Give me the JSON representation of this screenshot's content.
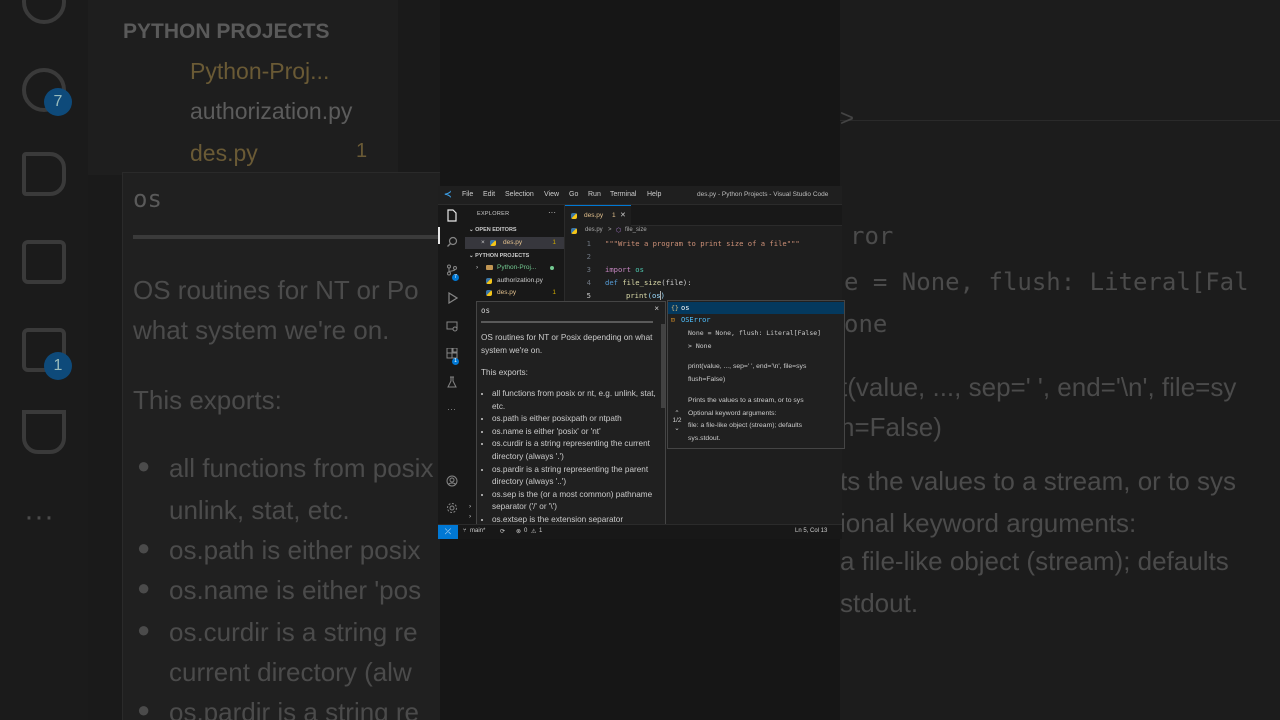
{
  "background": {
    "section_header": "PYTHON PROJECTS",
    "folder": "Python-Proj...",
    "file1": "authorization.py",
    "file2": "des.py",
    "file2_count": "1",
    "hover_title": "os",
    "hover_lines": [
      "OS routines for NT or Po",
      "what system we're on.",
      "This exports:",
      "all functions from posix",
      "unlink, stat, etc.",
      "os.path is either posix",
      "os.name is either 'pos",
      "os.curdir is a string re",
      "current directory (alw",
      "os.pardir is a string re"
    ],
    "right_lines": [
      "ror",
      "e = None, flush: Literal[Fal",
      "one",
      "t(value, ..., sep=' ', end='\\n', file=sy",
      "n=False)",
      "ts the values to a stream, or to sys",
      "ional keyword arguments:",
      "a file-like object (stream); defaults",
      "stdout."
    ],
    "badge_scm": "7",
    "badge_ext": "1"
  },
  "window": {
    "title": "des.py - Python Projects - Visual Studio Code",
    "menu": [
      "File",
      "Edit",
      "Selection",
      "View",
      "Go",
      "Run",
      "Terminal",
      "Help"
    ]
  },
  "activity": {
    "scm_badge": "7",
    "ext_badge": "1"
  },
  "sidebar": {
    "title": "EXPLORER",
    "open_editors_label": "OPEN EDITORS",
    "open_editors": [
      {
        "name": "des.py",
        "count": "1"
      }
    ],
    "project_label": "PYTHON PROJECTS",
    "items": [
      {
        "name": "Python-Proj...",
        "type": "folder"
      },
      {
        "name": "authorization.py",
        "type": "file"
      },
      {
        "name": "des.py",
        "type": "file",
        "count": "1"
      }
    ]
  },
  "tab": {
    "name": "des.py",
    "count": "1"
  },
  "breadcrumb": {
    "file": "des.py",
    "separator": ">",
    "symbol": "file_size"
  },
  "editor": {
    "line_numbers": [
      "1",
      "2",
      "3",
      "4",
      "5"
    ],
    "line1": "\"\"\"Write a program to print size of a file\"\"\"",
    "line3_kw": "import",
    "line3_mod": "os",
    "line4_kw": "def",
    "line4_fn": "file_size",
    "line4_rest": "(file):",
    "line5_fn": "print",
    "line5_rest": "(os)"
  },
  "suggest": {
    "items": [
      {
        "icon": "{}",
        "label": "os"
      },
      {
        "icon": "⊡",
        "label": "OSError"
      }
    ],
    "signature": [
      "None = None, flush: Literal[False]",
      "> None"
    ],
    "doc_lines": [
      "print(value, ..., sep=' ', end='\\n', file=sys",
      "flush=False)",
      "",
      "Prints the values to a stream, or to sys",
      "Optional keyword arguments:",
      "file: a file-like object (stream); defaults",
      "sys.stdout."
    ],
    "nav": "1/2"
  },
  "hover": {
    "title": "os",
    "para1": "OS routines for NT or Posix depending on what system we're on.",
    "para2": "This exports:",
    "bullets": [
      "all functions from posix or nt, e.g. unlink, stat, etc.",
      "os.path is either posixpath or ntpath",
      "os.name is either 'posix' or 'nt'",
      "os.curdir is a string representing the current directory (always '.')",
      "os.pardir is a string representing the parent directory (always '..')",
      "os.sep is the (or a most common) pathname separator ('/' or '\\')",
      "os.extsep is the extension separator"
    ]
  },
  "status": {
    "branch": "main*",
    "errors": "0",
    "warnings": "1",
    "position": "Ln 5, Col 13"
  }
}
